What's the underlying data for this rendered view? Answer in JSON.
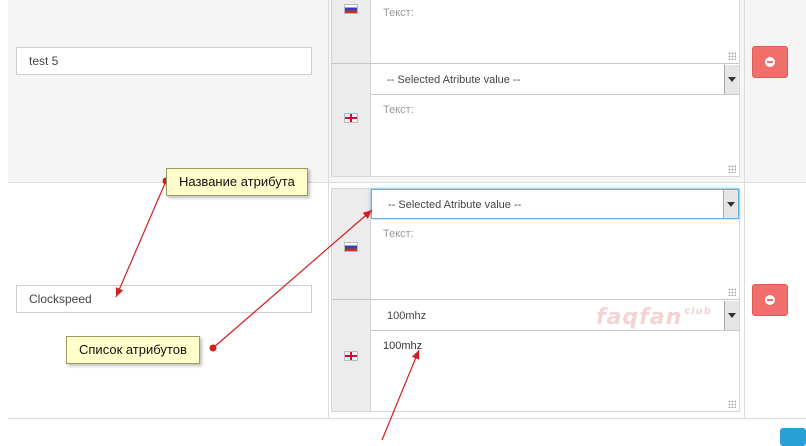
{
  "rows": [
    {
      "attribute_name": "test 5",
      "values": [
        {
          "flag_icon": "flag-ru-icon",
          "select_value": null,
          "text_placeholder": "Текст:",
          "text_value": ""
        },
        {
          "flag_icon": "flag-uk-icon",
          "select_value": "-- Selected Atribute value --",
          "text_placeholder": "Текст:",
          "text_value": ""
        }
      ]
    },
    {
      "attribute_name": "Clockspeed",
      "values": [
        {
          "flag_icon": "flag-ru-icon",
          "select_value": "-- Selected Atribute value --",
          "text_placeholder": "Текст:",
          "text_value": ""
        },
        {
          "flag_icon": "flag-uk-icon",
          "select_value": "100mhz",
          "text_placeholder": "Текст:",
          "text_value": "100mhz"
        }
      ]
    }
  ],
  "callouts": {
    "attribute_name": "Название атрибута",
    "attribute_list": "Список атрибутов"
  },
  "watermark": {
    "main": "faqfan",
    "sup": "club"
  },
  "colors": {
    "remove_button": "#f16f6b",
    "add_button": "#2a9fd6",
    "callout_bg": "#ffffcc",
    "focus": "#66afe9"
  }
}
